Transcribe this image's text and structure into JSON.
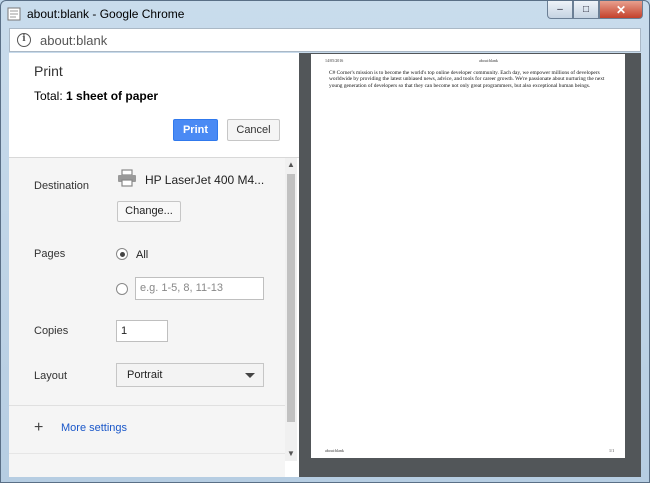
{
  "window": {
    "title": "about:blank - Google Chrome",
    "minimize": "‒",
    "maximize": "□",
    "close": "✕"
  },
  "address": {
    "url": "about:blank"
  },
  "print_panel": {
    "title": "Print",
    "total_prefix": "Total: ",
    "total_value": "1 sheet of paper",
    "print_button": "Print",
    "cancel_button": "Cancel",
    "destination": {
      "label": "Destination",
      "printer": "HP LaserJet 400 M4...",
      "change_button": "Change..."
    },
    "pages": {
      "label": "Pages",
      "option_all": "All",
      "custom_placeholder": "e.g. 1-5, 8, 11-13",
      "selected": "All"
    },
    "copies": {
      "label": "Copies",
      "value": "1"
    },
    "layout": {
      "label": "Layout",
      "value": "Portrait"
    },
    "more_settings": {
      "icon": "+",
      "label": "More settings"
    }
  },
  "preview": {
    "header_date": "14/05/2016",
    "header_title": "about:blank",
    "body_text": "C# Corner's mission is to become the world's top online developer community. Each day, we empower millions of developers worldwide by providing the latest unbiased news, advice, and tools for career growth. We're passionate about nurturing the next young generation of developers so that they can become not only great programmers, but also exceptional human beings.",
    "footer_left": "about:blank",
    "footer_right": "1/1"
  }
}
